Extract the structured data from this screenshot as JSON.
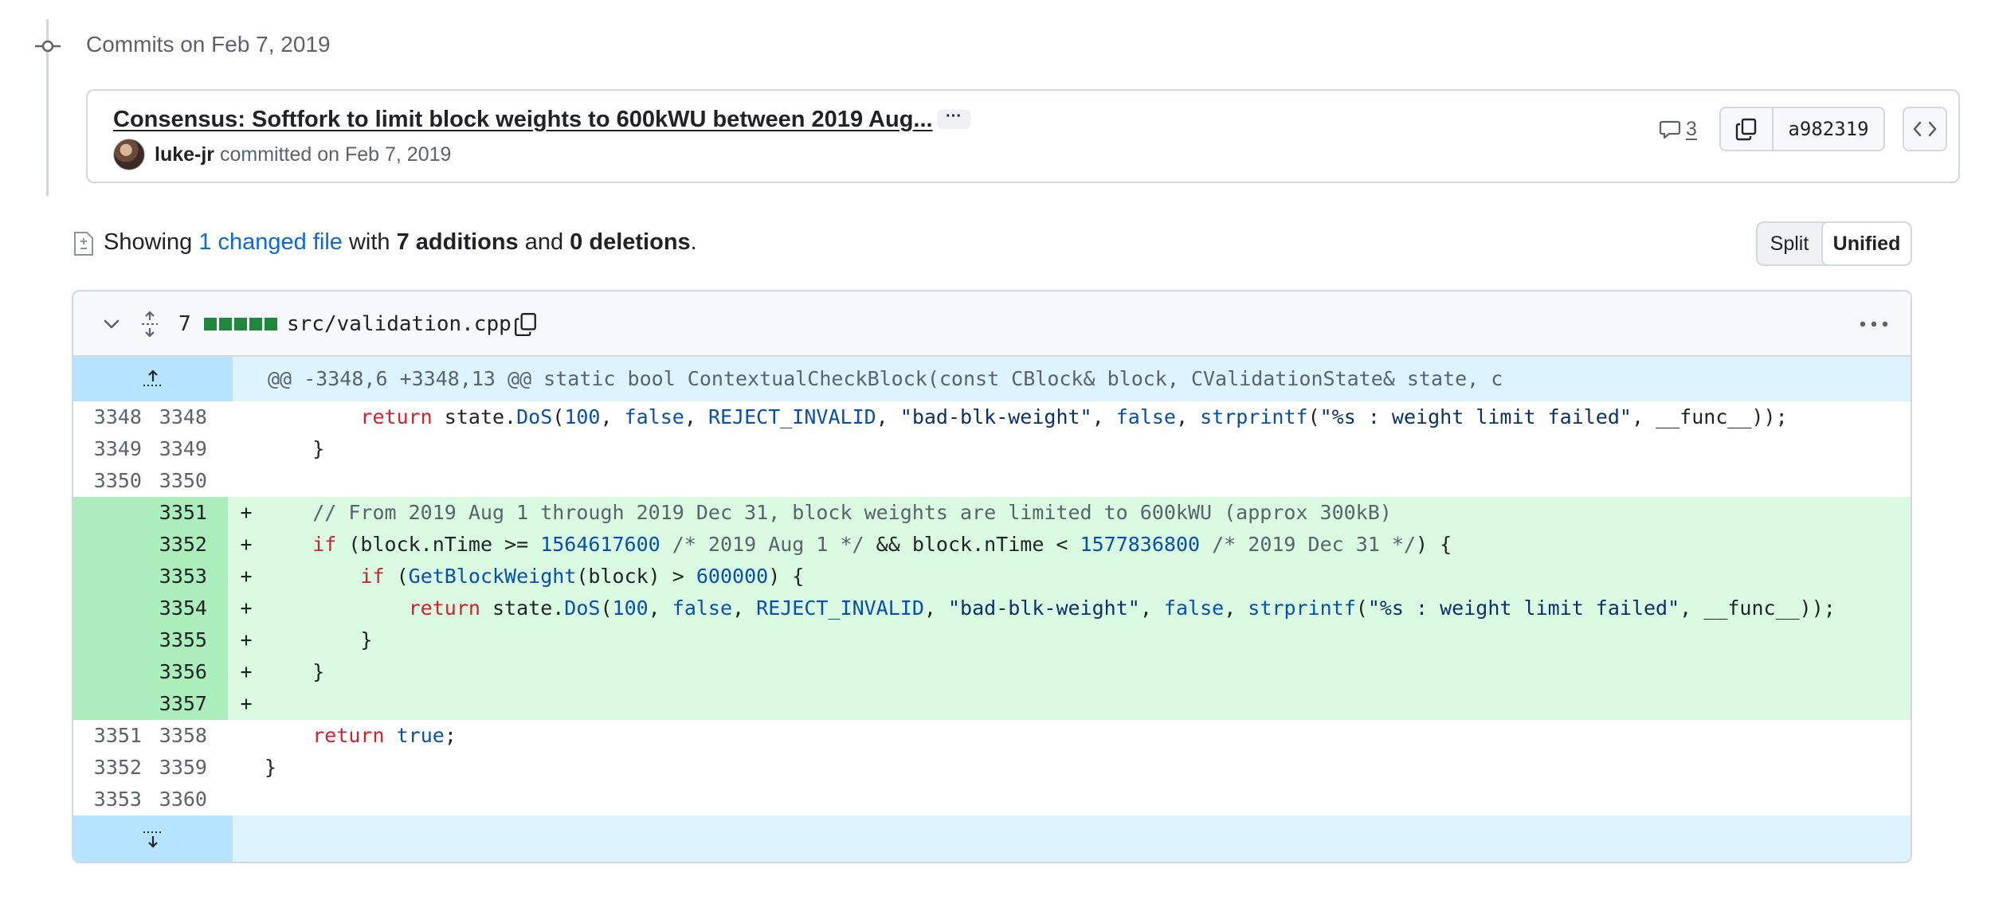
{
  "timeline": {
    "heading": "Commits on Feb 7, 2019"
  },
  "commit": {
    "title": "Consensus: Softfork to limit block weights to 600kWU between 2019 Aug...",
    "ellipsis": "···",
    "author": "luke-jr",
    "meta_rest": " committed on Feb 7, 2019",
    "comment_count": "3",
    "sha": "a982319"
  },
  "summary": {
    "prefix": "Showing ",
    "changed_files": "1 changed file",
    "with": " with ",
    "additions": "7 additions",
    "and": " and ",
    "deletions": "0 deletions",
    "suffix": "."
  },
  "view_toggle": {
    "split": "Split",
    "unified": "Unified"
  },
  "file": {
    "change_count": "7",
    "name": "src/validation.cpp",
    "hunk_header": "@@ -3348,6 +3348,13 @@ static bool ContextualCheckBlock(const CBlock& block, CValidationState& state, c",
    "lines": [
      {
        "type": "context",
        "old": "3348",
        "new": "3348",
        "sign": " ",
        "code": "        return state.DoS(100, false, REJECT_INVALID, \"bad-blk-weight\", false, strprintf(\"%s : weight limit failed\", __func__));"
      },
      {
        "type": "context",
        "old": "3349",
        "new": "3349",
        "sign": " ",
        "code": "    }"
      },
      {
        "type": "context",
        "old": "3350",
        "new": "3350",
        "sign": " ",
        "code": ""
      },
      {
        "type": "add",
        "old": "",
        "new": "3351",
        "sign": "+",
        "code": "    // From 2019 Aug 1 through 2019 Dec 31, block weights are limited to 600kWU (approx 300kB)"
      },
      {
        "type": "add",
        "old": "",
        "new": "3352",
        "sign": "+",
        "code": "    if (block.nTime >= 1564617600 /* 2019 Aug 1 */ && block.nTime < 1577836800 /* 2019 Dec 31 */) {"
      },
      {
        "type": "add",
        "old": "",
        "new": "3353",
        "sign": "+",
        "code": "        if (GetBlockWeight(block) > 600000) {"
      },
      {
        "type": "add",
        "old": "",
        "new": "3354",
        "sign": "+",
        "code": "            return state.DoS(100, false, REJECT_INVALID, \"bad-blk-weight\", false, strprintf(\"%s : weight limit failed\", __func__));"
      },
      {
        "type": "add",
        "old": "",
        "new": "3355",
        "sign": "+",
        "code": "        }"
      },
      {
        "type": "add",
        "old": "",
        "new": "3356",
        "sign": "+",
        "code": "    }"
      },
      {
        "type": "add",
        "old": "",
        "new": "3357",
        "sign": "+",
        "code": ""
      },
      {
        "type": "context",
        "old": "3351",
        "new": "3358",
        "sign": " ",
        "code": "    return true;"
      },
      {
        "type": "context",
        "old": "3352",
        "new": "3359",
        "sign": " ",
        "code": "}"
      },
      {
        "type": "context",
        "old": "3353",
        "new": "3360",
        "sign": " ",
        "code": ""
      }
    ]
  },
  "colors": {
    "addition_bg": "#dafbe1",
    "addition_gutter": "#aceebb",
    "hunk_bg": "#ddf4ff",
    "link": "#0969da",
    "diffstat_green": "#1f883d"
  }
}
